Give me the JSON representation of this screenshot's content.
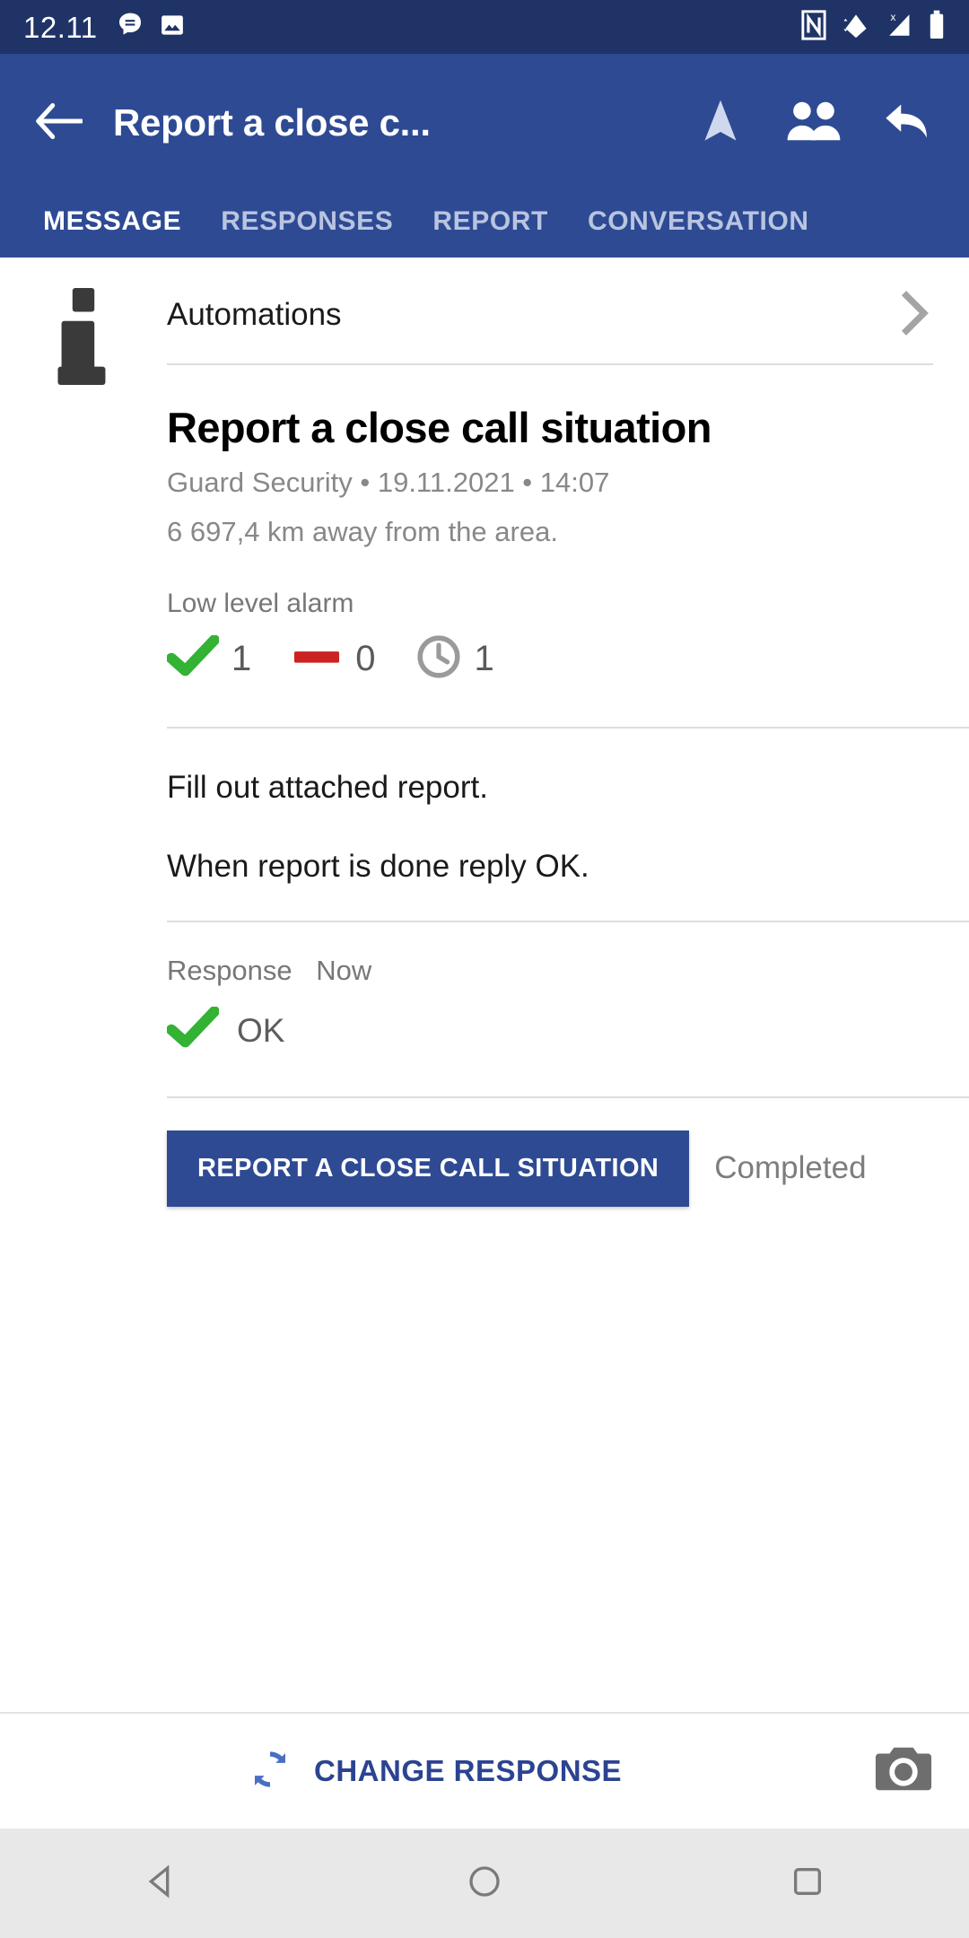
{
  "status_bar": {
    "time": "12.11",
    "left_icons": [
      "message-icon",
      "image-icon"
    ],
    "right_icons": [
      "nfc-icon",
      "wifi-icon",
      "cellular-signal-icon",
      "battery-icon"
    ],
    "background_color": "#1f3367"
  },
  "app_bar": {
    "back_icon": "back-arrow-icon",
    "title": "Report a close c...",
    "actions": [
      "navigation-arrow-icon",
      "people-icon",
      "reply-arrow-icon"
    ],
    "background_color": "#2e4a93"
  },
  "tabs": [
    {
      "label": "MESSAGE",
      "active": true
    },
    {
      "label": "RESPONSES",
      "active": false
    },
    {
      "label": "REPORT",
      "active": false
    },
    {
      "label": "CONVERSATION",
      "active": false
    }
  ],
  "content": {
    "info_icon": "info-icon",
    "automations": {
      "label": "Automations",
      "chevron": "chevron-right-icon"
    },
    "message": {
      "title": "Report a close call situation",
      "meta": "Guard Security • 19.11.2021 • 14:07",
      "distance": "6 697,4 km away from the area.",
      "alarm_label": "Low level alarm",
      "alarm_stats": [
        {
          "icon": "green-check-icon",
          "value": "1",
          "color": "#33b233"
        },
        {
          "icon": "red-minus-icon",
          "value": "0",
          "color": "#cc2222"
        },
        {
          "icon": "gray-clock-icon",
          "value": "1",
          "color": "#9a9a9a"
        }
      ],
      "body_lines": [
        "Fill out attached report.",
        "When report is done reply OK."
      ]
    },
    "response": {
      "label": "Response",
      "time": "Now",
      "icon": "green-check-icon",
      "value": "OK"
    },
    "action": {
      "button_label": "REPORT A CLOSE CALL SITUATION",
      "status": "Completed",
      "button_color": "#2e4a93"
    }
  },
  "bottom_bar": {
    "change_response_icon": "refresh-icon",
    "change_response_label": "CHANGE RESPONSE",
    "camera_icon": "camera-icon",
    "accent_color": "#2b4391"
  },
  "nav_bar": {
    "buttons": [
      "back-triangle-icon",
      "home-circle-icon",
      "recents-square-icon"
    ]
  }
}
